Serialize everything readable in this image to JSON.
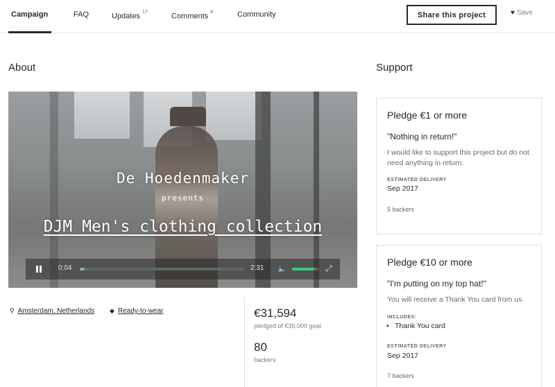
{
  "nav": {
    "tabs": [
      {
        "label": "Campaign",
        "count": ""
      },
      {
        "label": "FAQ",
        "count": ""
      },
      {
        "label": "Updates",
        "count": "17"
      },
      {
        "label": "Comments",
        "count": "8"
      },
      {
        "label": "Community",
        "count": ""
      }
    ],
    "active_tab": "Campaign",
    "share_label": "Share this project",
    "save_label": "Save"
  },
  "about": {
    "heading": "About",
    "video": {
      "title_line1": "De Hoedenmaker",
      "title_line2": "presents",
      "title_line3": "DJM Men's clothing collection",
      "current_time": "0:04",
      "duration": "2:31",
      "progress": 0.03,
      "volume": 0.85
    },
    "location": "Amsterdam, Netherlands",
    "category": "Ready-to-wear",
    "pledged_amount": "€31,594",
    "pledged_caption": "pledged of €30,000 goal",
    "backers_count": "80",
    "backers_caption": "backers"
  },
  "support": {
    "heading": "Support",
    "rewards": [
      {
        "pledge": "Pledge €1 or more",
        "title": "\"Nothing in return!\"",
        "description": "I would like to support this project but do not need anything in return.",
        "delivery_label": "ESTIMATED DELIVERY",
        "delivery": "Sep 2017",
        "backers": "5 backers"
      },
      {
        "pledge": "Pledge €10 or more",
        "title": "\"I'm putting on my top hat!\"",
        "description": "You will receive a Thank You card from us.",
        "includes_label": "INCLUDES:",
        "includes": [
          "Thank You card"
        ],
        "delivery_label": "ESTIMATED DELIVERY",
        "delivery": "Sep 2017",
        "backers": "7 backers"
      }
    ]
  },
  "colors": {
    "text": "#282828",
    "muted": "#656969",
    "accent_green": "#2b8a5a",
    "border": "#dcdedd"
  }
}
